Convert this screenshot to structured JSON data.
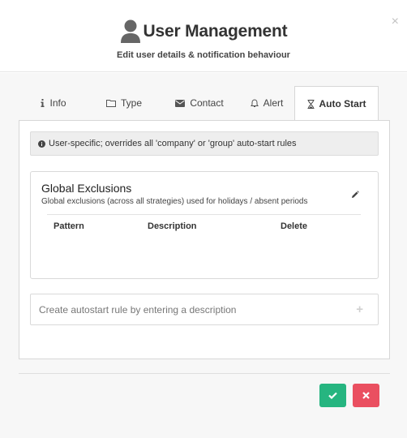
{
  "dialog": {
    "title": "User Management",
    "subtitle": "Edit user details & notification behaviour",
    "close_symbol": "×"
  },
  "tabs": [
    {
      "label": "Info",
      "icon": "info-icon",
      "active": false
    },
    {
      "label": "Type",
      "icon": "folder-icon",
      "active": false
    },
    {
      "label": "Contact",
      "icon": "envelope-icon",
      "active": false
    },
    {
      "label": "Alert",
      "icon": "bell-icon",
      "active": false
    },
    {
      "label": "Auto Start",
      "icon": "hourglass-icon",
      "active": true
    }
  ],
  "autostart": {
    "info_text": "User-specific; overrides all 'company' or 'group' auto-start rules",
    "exclusions": {
      "title": "Global Exclusions",
      "description": "Global exclusions (across all strategies) used for holidays / absent periods",
      "columns": [
        "Pattern",
        "Description",
        "Delete"
      ]
    },
    "create": {
      "placeholder": "Create autostart rule by entering a description",
      "value": "",
      "add_symbol": "+"
    }
  },
  "colors": {
    "confirm": "#26b580",
    "cancel": "#ea4f60",
    "background": "#f7f7f7"
  }
}
